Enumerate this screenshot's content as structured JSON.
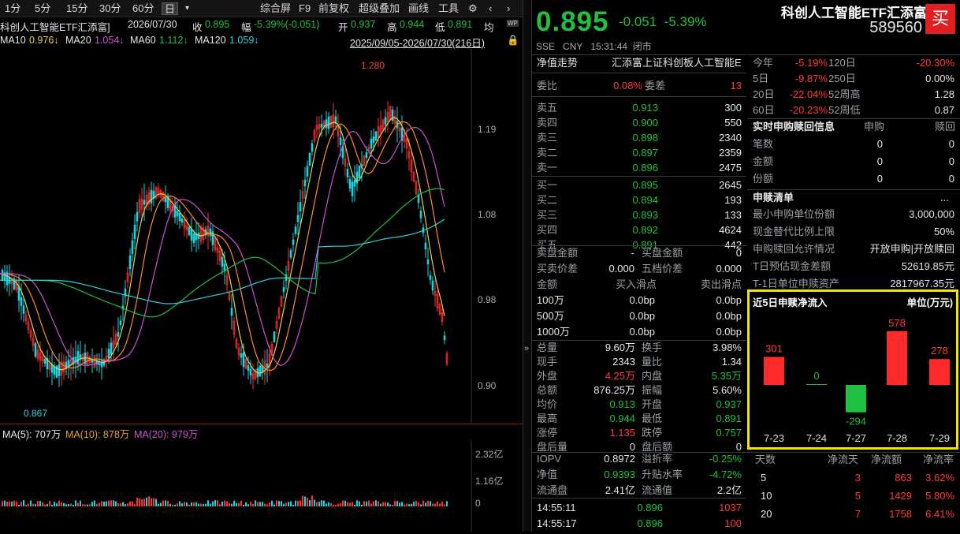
{
  "toolbar": {
    "periods": [
      "1分",
      "5分",
      "15分",
      "30分",
      "60分",
      "日"
    ],
    "menu": [
      "综合屏",
      "F9",
      "前复权",
      "超级叠加",
      "画线",
      "工具"
    ]
  },
  "info": {
    "name": "科创人工智能ETF汇添富]",
    "date": "2026/07/30",
    "close_label": "收",
    "close": "0.895",
    "amp_label": "幅",
    "amp": "-5.39%(-0.051)",
    "open_label": "开",
    "open": "0.937",
    "high_label": "高",
    "high": "0.944",
    "low_label": "低",
    "low": "0.891",
    "avg_label": "均"
  },
  "ma": {
    "ma10": "MA10",
    "ma10_val": "0.976↓",
    "ma20": "MA20",
    "ma20_val": "1.054↓",
    "ma60": "MA60",
    "ma60_val": "1.112↓",
    "ma120": "MA120",
    "ma120_val": "1.059↓",
    "range": "2025/09/05-2026/07/30(216日)"
  },
  "kchart": {
    "y_ticks": [
      "1.19",
      "1.08",
      "0.98",
      "0.90"
    ],
    "high_label": "1.280",
    "low_label": "0.867"
  },
  "vol": {
    "ma5": "MA(5): 707万",
    "ma10": "MA(10): 878万",
    "ma20": "MA(20): 979万",
    "y_ticks": [
      "2.32亿",
      "1.16亿",
      "0"
    ]
  },
  "header": {
    "title": "科创人工智能ETF汇添富",
    "code": "589560",
    "buy": "买",
    "price": "0.895",
    "change": "-0.051",
    "change_pct": "-5.39%",
    "exch": "SSE",
    "currency": "CNY",
    "time": "15:31:44",
    "status": "闭市"
  },
  "nav": {
    "label": "净值走势",
    "value": "汇添富上证科创板人工智能E"
  },
  "weibi": {
    "label1": "委比",
    "val1": "0.08%",
    "label2": "委差",
    "val2": "13"
  },
  "asks": [
    {
      "l": "卖五",
      "p": "0.913",
      "v": "300"
    },
    {
      "l": "卖四",
      "p": "0.900",
      "v": "550"
    },
    {
      "l": "卖三",
      "p": "0.898",
      "v": "2340"
    },
    {
      "l": "卖二",
      "p": "0.897",
      "v": "2359"
    },
    {
      "l": "卖一",
      "p": "0.896",
      "v": "2475"
    }
  ],
  "bids": [
    {
      "l": "买一",
      "p": "0.895",
      "v": "2645"
    },
    {
      "l": "买二",
      "p": "0.894",
      "v": "193"
    },
    {
      "l": "买三",
      "p": "0.893",
      "v": "133"
    },
    {
      "l": "买四",
      "p": "0.892",
      "v": "4624"
    },
    {
      "l": "买五",
      "p": "0.891",
      "v": "442"
    }
  ],
  "amounts": {
    "sell_amt": "卖盘金额",
    "sell_amt_v": "-",
    "buy_amt": "买盘金额",
    "buy_amt_v": "0",
    "buy_spread": "买卖价差",
    "buy_spread_v": "0.000",
    "five_spread": "五档价差",
    "five_spread_v": "0.000"
  },
  "slip": {
    "h1": "金额",
    "h2": "买入滑点",
    "h3": "卖出滑点",
    "rows": [
      {
        "a": "100万",
        "b": "0.0bp",
        "s": "0.0bp"
      },
      {
        "a": "500万",
        "b": "0.0bp",
        "s": "0.0bp"
      },
      {
        "a": "1000万",
        "b": "0.0bp",
        "s": "0.0bp"
      }
    ]
  },
  "stats": [
    {
      "l1": "总量",
      "v1": "9.60万",
      "l2": "换手",
      "v2": "3.98%"
    },
    {
      "l1": "现手",
      "v1": "2343",
      "l2": "量比",
      "v2": "1.34"
    },
    {
      "l1": "外盘",
      "v1": "4.25万",
      "l2": "内盘",
      "v2": "5.35万"
    },
    {
      "l1": "总额",
      "v1": "876.25万",
      "l2": "振幅",
      "v2": "5.60%"
    },
    {
      "l1": "均价",
      "v1": "0.913",
      "l2": "开盘",
      "v2": "0.937"
    },
    {
      "l1": "最高",
      "v1": "0.944",
      "l2": "最低",
      "v2": "0.891"
    },
    {
      "l1": "涨停",
      "v1": "1.135",
      "l2": "跌停",
      "v2": "0.757"
    },
    {
      "l1": "盘后量",
      "v1": "0",
      "l2": "盘后额",
      "v2": "0"
    }
  ],
  "iopv": [
    {
      "l1": "IOPV",
      "v1": "0.8972",
      "l2": "溢折率",
      "v2": "-0.25%"
    },
    {
      "l1": "净值",
      "v1": "0.9393",
      "l2": "升贴水率",
      "v2": "-4.72%"
    },
    {
      "l1": "流通盘",
      "v1": "2.41亿",
      "l2": "流通值",
      "v2": "2.2亿"
    }
  ],
  "ticks": [
    {
      "t": "14:55:11",
      "p": "0.896",
      "v": "1037"
    },
    {
      "t": "14:55:17",
      "p": "0.896",
      "v": "100"
    }
  ],
  "periods": [
    {
      "l1": "今年",
      "v1": "-5.19%",
      "l2": "120日",
      "v2": "-20.30%"
    },
    {
      "l1": "5日",
      "v1": "-9.87%",
      "l2": "250日",
      "v2": "0.00%"
    },
    {
      "l1": "20日",
      "v1": "-22.04%",
      "l2": "52周高",
      "v2": "1.28"
    },
    {
      "l1": "60日",
      "v1": "-20.23%",
      "l2": "52周低",
      "v2": "0.87"
    }
  ],
  "sub": {
    "title": "实时申购赎回信息",
    "h1": "申购",
    "h2": "赎回",
    "rows": [
      {
        "l": "笔数",
        "a": "0",
        "b": "0"
      },
      {
        "l": "金额",
        "a": "0",
        "b": "0"
      },
      {
        "l": "份额",
        "a": "0",
        "b": "0"
      }
    ]
  },
  "list": {
    "title": "申赎清单",
    "more": "...",
    "rows": [
      {
        "l": "最小申购单位份额",
        "v": "3,000,000"
      },
      {
        "l": "现金替代比例上限",
        "v": "50%"
      },
      {
        "l": "申购赎回允许情况",
        "v": "开放申购|开放赎回"
      },
      {
        "l": "T日预估现金差额",
        "v": "52619.85元"
      },
      {
        "l": "T-1日单位申赎资产",
        "v": "2817967.35元"
      }
    ]
  },
  "chart_data": {
    "type": "bar",
    "title": "近5日申赎净流入",
    "unit": "单位(万元)",
    "categories": [
      "7-23",
      "7-24",
      "7-27",
      "7-28",
      "7-29"
    ],
    "values": [
      301,
      0,
      -294,
      578,
      278
    ],
    "colors": {
      "positive": "#ff2a2a",
      "negative": "#20c040"
    }
  },
  "netflow": {
    "headers": [
      "天数",
      "净流天",
      "净流额",
      "净流率"
    ],
    "rows": [
      {
        "d": "5",
        "n": "3",
        "a": "863",
        "r": "3.62%"
      },
      {
        "d": "10",
        "n": "5",
        "a": "1429",
        "r": "5.80%"
      },
      {
        "d": "20",
        "n": "7",
        "a": "1758",
        "r": "6.41%"
      }
    ]
  }
}
